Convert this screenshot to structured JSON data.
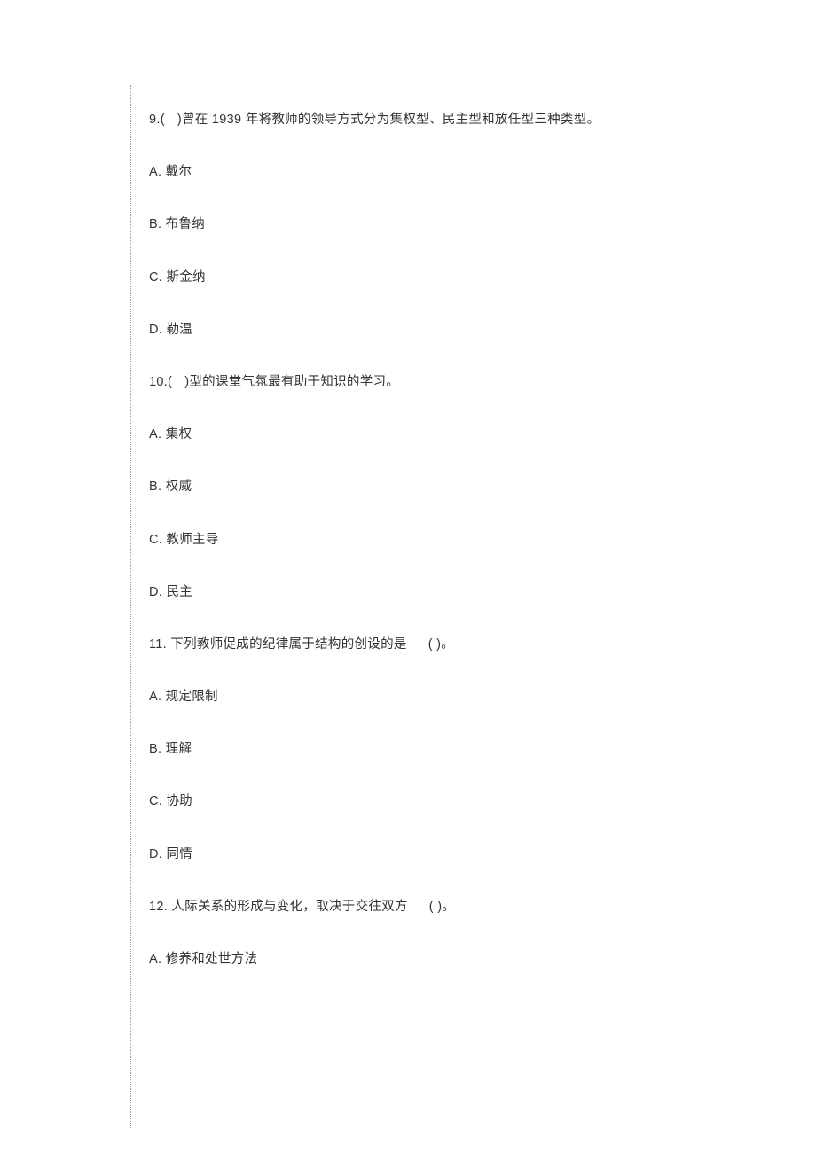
{
  "questions": [
    {
      "number": "9",
      "stem_prefix": "9.(",
      "stem_suffix": ")曾在",
      "year": "1939",
      "stem_tail": "年将教师的领导方式分为集权型、民主型和放任型三种类型。",
      "options": [
        {
          "label": "A.",
          "text": "戴尔"
        },
        {
          "label": "B.",
          "text": "布鲁纳"
        },
        {
          "label": "C.",
          "text": "斯金纳"
        },
        {
          "label": "D.",
          "text": "勒温"
        }
      ]
    },
    {
      "number": "10",
      "stem_prefix": "10.(",
      "stem_suffix": ")型的课堂气氛最有助于知识的学习。",
      "options": [
        {
          "label": "A.",
          "text": "集权"
        },
        {
          "label": "B.",
          "text": "权威"
        },
        {
          "label": "C.",
          "text": "教师主导"
        },
        {
          "label": "D.",
          "text": "民主"
        }
      ]
    },
    {
      "number": "11",
      "stem_main": "11. 下列教师促成的纪律属于结构的创设的是",
      "stem_blank": "(   )。",
      "options": [
        {
          "label": "A.",
          "text": "规定限制"
        },
        {
          "label": "B.",
          "text": "理解"
        },
        {
          "label": "C.",
          "text": "协助"
        },
        {
          "label": "D.",
          "text": "同情"
        }
      ]
    },
    {
      "number": "12",
      "stem_main": "12. 人际关系的形成与变化，取决于交往双方",
      "stem_blank": "(   )。",
      "options": [
        {
          "label": "A.",
          "text": "修养和处世方法"
        }
      ]
    }
  ]
}
